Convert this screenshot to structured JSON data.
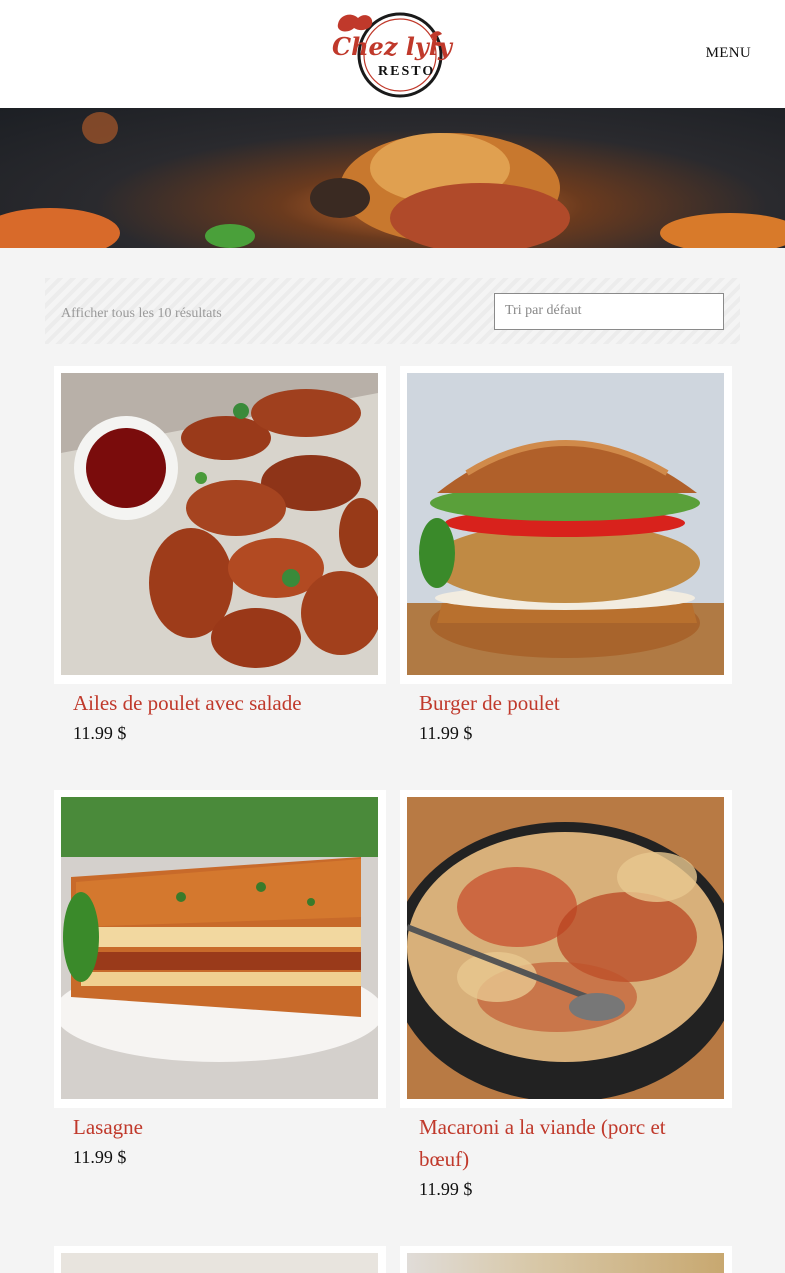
{
  "header": {
    "logo_text_main": "Chez lyly",
    "logo_text_sub": "RESTO",
    "menu_label": "MENU"
  },
  "shop": {
    "result_count": "Afficher tous les 10 résultats",
    "sort_selected": "Tri par défaut"
  },
  "products": [
    {
      "title": "Ailes de poulet avec salade",
      "price": "11.99 $"
    },
    {
      "title": "Burger de poulet",
      "price": "11.99 $"
    },
    {
      "title": "Lasagne",
      "price": "11.99 $"
    },
    {
      "title": "Macaroni a la viande (porc et bœuf)",
      "price": "11.99 $"
    }
  ],
  "colors": {
    "accent": "#c0392b",
    "background": "#f4f4f4"
  }
}
